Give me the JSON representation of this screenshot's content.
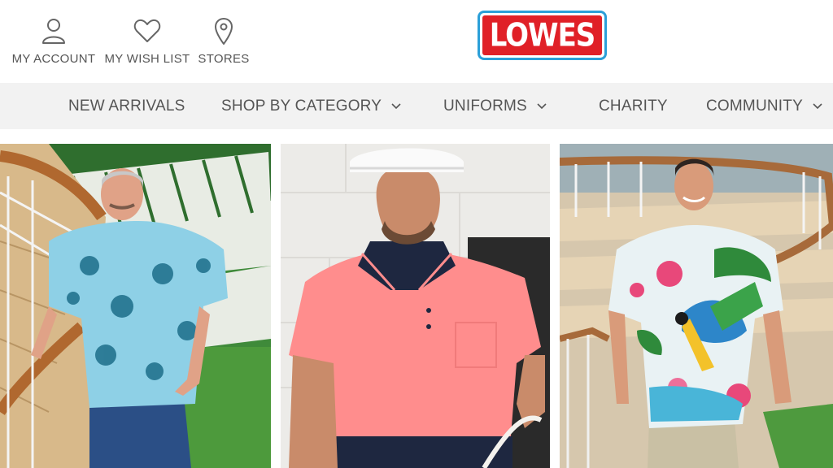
{
  "header": {
    "account": {
      "label": "MY ACCOUNT",
      "icon": "user-icon"
    },
    "wishlist": {
      "label": "MY WISH LIST",
      "icon": "heart-icon"
    },
    "stores": {
      "label": "STORES",
      "icon": "map-pin-icon"
    },
    "logo": {
      "text": "LOWES",
      "colors": {
        "border": "#2b9fd8",
        "fill": "#e02027",
        "text": "#ffffff"
      }
    }
  },
  "nav": {
    "items": [
      {
        "label": "NEW ARRIVALS",
        "has_dropdown": false
      },
      {
        "label": "SHOP BY CATEGORY",
        "has_dropdown": true
      },
      {
        "label": "UNIFORMS",
        "has_dropdown": true
      },
      {
        "label": "CHARITY",
        "has_dropdown": false
      },
      {
        "label": "COMMUNITY",
        "has_dropdown": true
      }
    ],
    "background": "#f2f2f2"
  },
  "promo_tiles": [
    {
      "subject": "man in blue tropical print shirt on cruise ship deck"
    },
    {
      "subject": "man in hard hat and hi-vis pink polo"
    },
    {
      "subject": "man in parrot and hibiscus print shirt on cruise ship deck"
    }
  ]
}
